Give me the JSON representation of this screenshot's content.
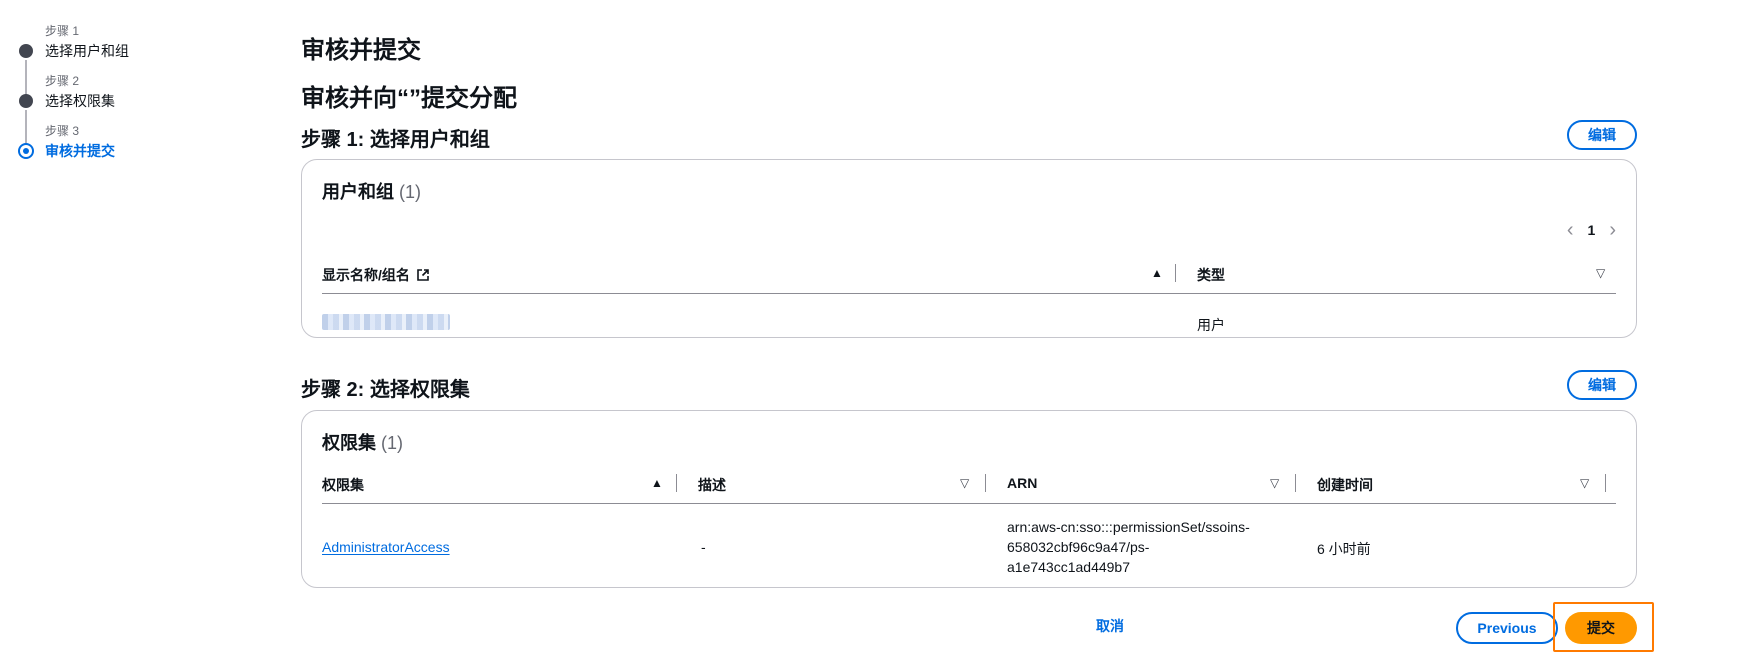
{
  "wizard": {
    "steps": [
      {
        "num": "步骤 1",
        "label": "选择用户和组",
        "state": "done"
      },
      {
        "num": "步骤 2",
        "label": "选择权限集",
        "state": "done"
      },
      {
        "num": "步骤 3",
        "label": "审核并提交",
        "state": "active"
      }
    ]
  },
  "page": {
    "title": "审核并提交",
    "subtitle": "审核并向“”提交分配"
  },
  "section1": {
    "title": "步骤 1: 选择用户和组",
    "edit_label": "编辑",
    "panel_title": "用户和组",
    "count": "(1)",
    "pager": {
      "prev": "‹",
      "page": "1",
      "next": "›"
    },
    "columns": [
      "显示名称/组名",
      "类型"
    ],
    "rows": [
      {
        "name": "",
        "type": "用户"
      }
    ]
  },
  "section2": {
    "title": "步骤 2: 选择权限集",
    "edit_label": "编辑",
    "panel_title": "权限集",
    "count": "(1)",
    "columns": [
      "权限集",
      "描述",
      "ARN",
      "创建时间"
    ],
    "rows": [
      {
        "name": "AdministratorAccess",
        "description": "-",
        "arn_lines": [
          "arn:aws-cn:sso:::permissionSet/ssoins-",
          "658032cbf96c9a47/ps-",
          "a1e743cc1ad449b7"
        ],
        "created": "6 小时前"
      }
    ]
  },
  "footer": {
    "cancel_label": "取消",
    "previous_label": "Previous",
    "submit_label": "提交"
  },
  "colors": {
    "accent": "#006ce0",
    "submit": "#ff9900",
    "highlight": "#ff7a00"
  }
}
